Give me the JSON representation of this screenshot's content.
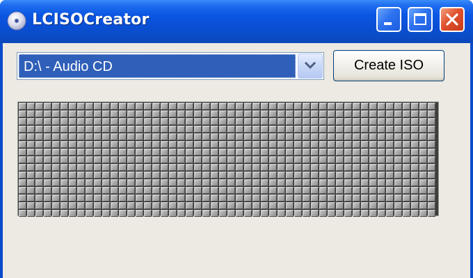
{
  "window": {
    "title": "LCISOCreator",
    "title_icon": "cd-disc-icon",
    "controls": {
      "minimize_icon": "minimize-icon",
      "maximize_icon": "maximize-icon",
      "close_icon": "close-icon"
    }
  },
  "toolbar": {
    "drive_select": {
      "value": "D:\\ - Audio CD",
      "arrow_icon": "chevron-down-icon"
    },
    "create_button_label": "Create ISO"
  },
  "block_map": {
    "columns": 50,
    "rows": 15,
    "block_state": "unused"
  },
  "colors": {
    "titlebar": "#0a4fd6",
    "client_background": "#eceae3",
    "selection": "#2f5fb8",
    "close_button": "#e0522f"
  }
}
